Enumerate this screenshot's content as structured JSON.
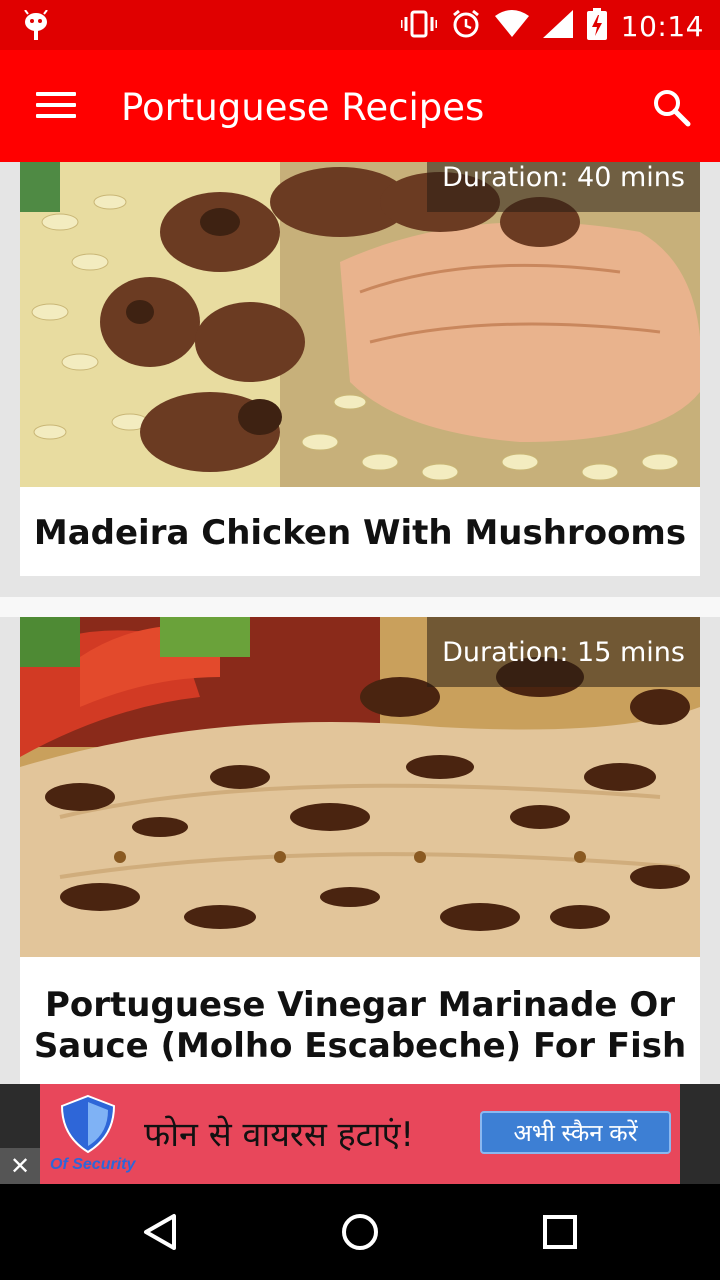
{
  "status_bar": {
    "time": "10:14",
    "icons": [
      "android-debug-icon",
      "vibrate-icon",
      "alarm-icon",
      "wifi-icon",
      "signal-icon",
      "battery-charging-icon"
    ]
  },
  "app_bar": {
    "title": "Portuguese Recipes",
    "icons": [
      "menu-icon",
      "search-icon"
    ]
  },
  "recipes": [
    {
      "title": "Madeira Chicken With Mushrooms",
      "duration": "Duration: 40 mins"
    },
    {
      "title": "Portuguese Vinegar Marinade Or Sauce (Molho Escabeche) For Fish",
      "duration": "Duration: 15 mins"
    }
  ],
  "ad": {
    "brand": "Of Security",
    "text": "फोन से वायरस हटाएं!",
    "cta": "अभी स्कैन करें",
    "close": "✕"
  },
  "nav_bar": {
    "icons": [
      "back-icon",
      "home-icon",
      "recents-icon"
    ]
  },
  "colors": {
    "status_bar": "#e00000",
    "app_bar": "#ff0000",
    "ad_background": "#e8475b",
    "ad_cta": "#3d7fd4"
  }
}
